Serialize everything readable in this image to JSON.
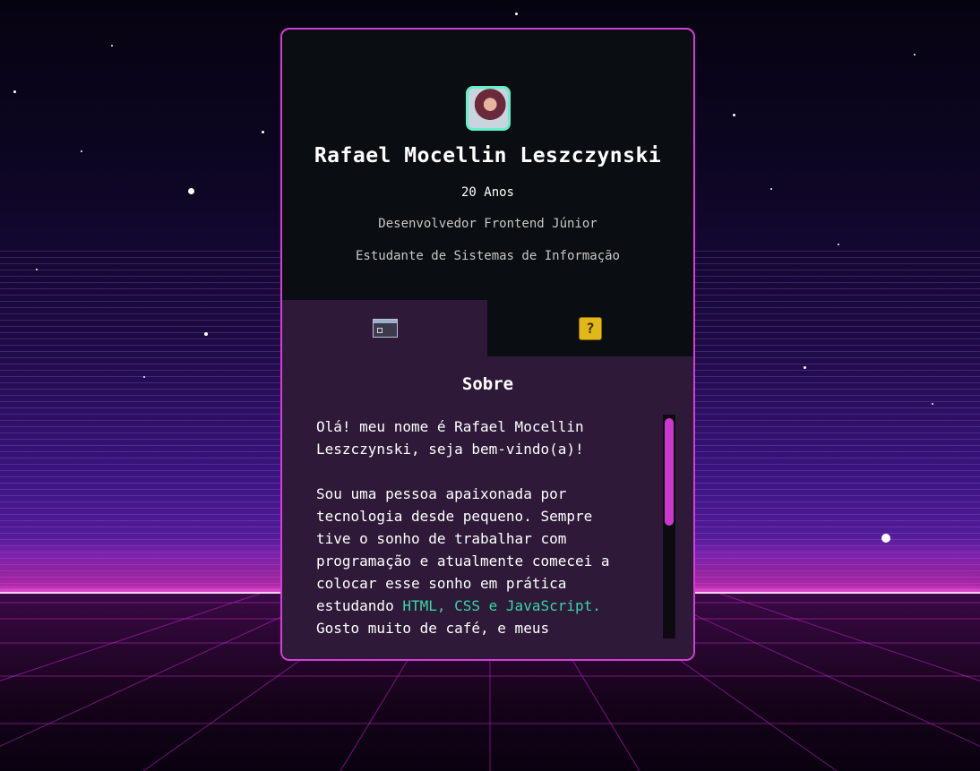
{
  "profile": {
    "name": "Rafael Mocellin Leszczynski",
    "age": "20 Anos",
    "role": "Desenvolvedor Frontend Júnior",
    "study": "Estudante de Sistemas de Informação"
  },
  "tabs": [
    {
      "icon": "window-icon",
      "active": true
    },
    {
      "icon": "question-block-icon",
      "active": false
    }
  ],
  "about": {
    "title": "Sobre",
    "text_lines": [
      "Olá! meu nome é Rafael Mocellin",
      "Leszczynski, seja bem-vindo(a)!",
      "",
      "Sou uma pessoa apaixonada por",
      "tecnologia desde pequeno. Sempre",
      "tive o sonho de trabalhar com",
      "programação e atualmente comecei a",
      "colocar esse sonho em prática"
    ],
    "studying_prefix": "estudando ",
    "highlight": "HTML, CSS e JavaScript.",
    "text_after": "Gosto muito de café, e meus"
  },
  "colors": {
    "accent_border": "#d43ed8",
    "avatar_border": "#64f0c8",
    "highlight": "#34d7a6",
    "panel_bg": "#2e1a38",
    "card_bg": "#0a0d12",
    "scroll_thumb": "#cc38cc"
  }
}
